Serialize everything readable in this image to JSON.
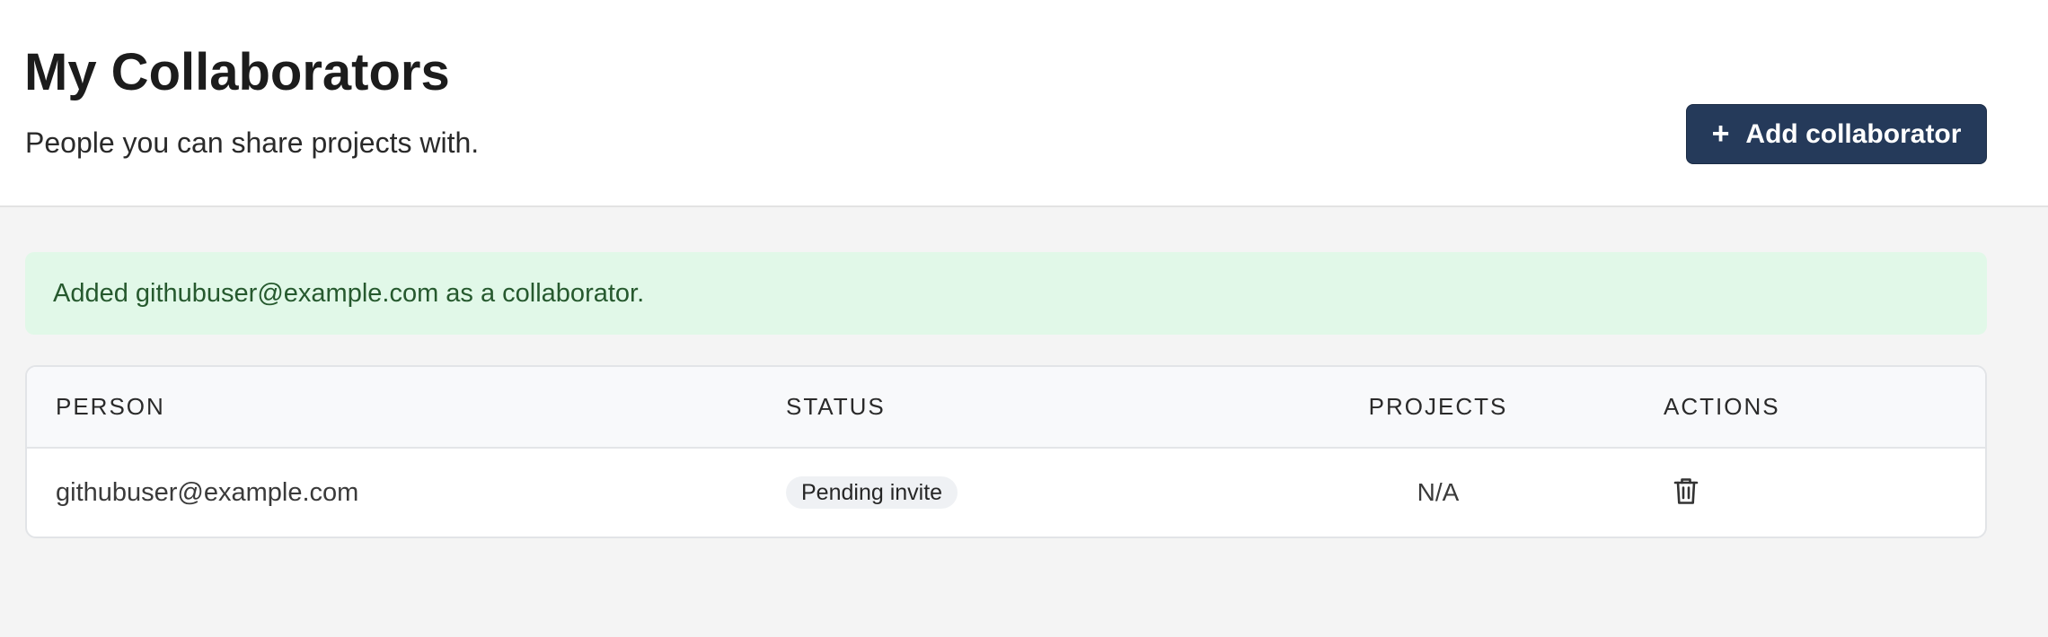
{
  "header": {
    "title": "My Collaborators",
    "subtitle": "People you can share projects with.",
    "add_button_icon": "plus-icon",
    "add_button_label": "Add collaborator",
    "add_button_color": "#253a5a"
  },
  "alert": {
    "message": "Added githubuser@example.com as a collaborator.",
    "background_color": "#e1f8e8",
    "text_color": "#26592e"
  },
  "table": {
    "columns": [
      "PERSON",
      "STATUS",
      "PROJECTS",
      "ACTIONS"
    ],
    "rows": [
      {
        "person": "githubuser@example.com",
        "status": "Pending invite",
        "projects": "N/A",
        "action_icon": "trash-icon"
      }
    ]
  }
}
